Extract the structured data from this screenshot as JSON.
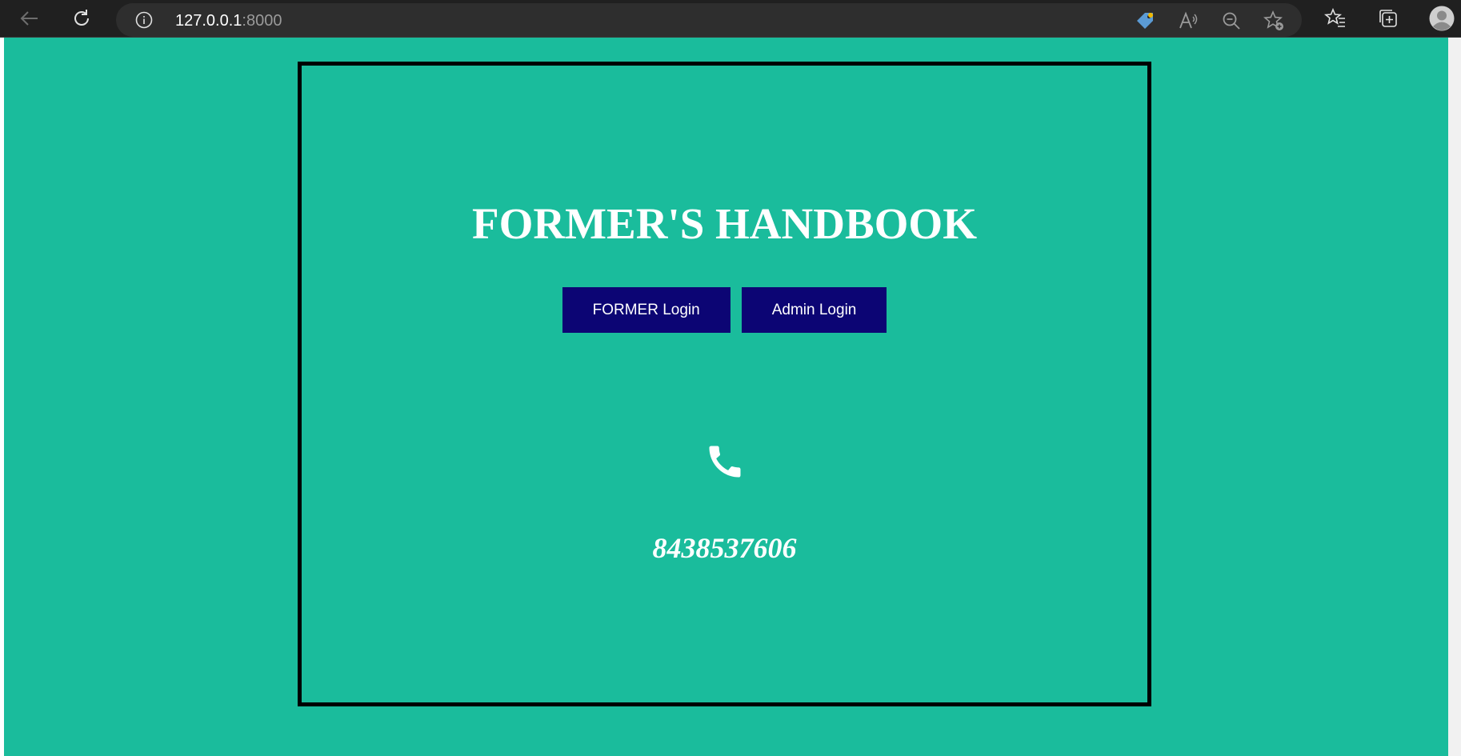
{
  "browser": {
    "url_host": "127.0.0.1",
    "url_port": ":8000"
  },
  "page": {
    "title": "FORMER'S HANDBOOK",
    "buttons": {
      "former_login": "FORMER Login",
      "admin_login": "Admin Login"
    },
    "contact": {
      "icon": "phone-icon",
      "phone_number": "8438537606"
    }
  },
  "colors": {
    "page_background": "#1abc9c",
    "button_background": "#0c0574",
    "card_border": "#000000",
    "text": "#ffffff"
  }
}
